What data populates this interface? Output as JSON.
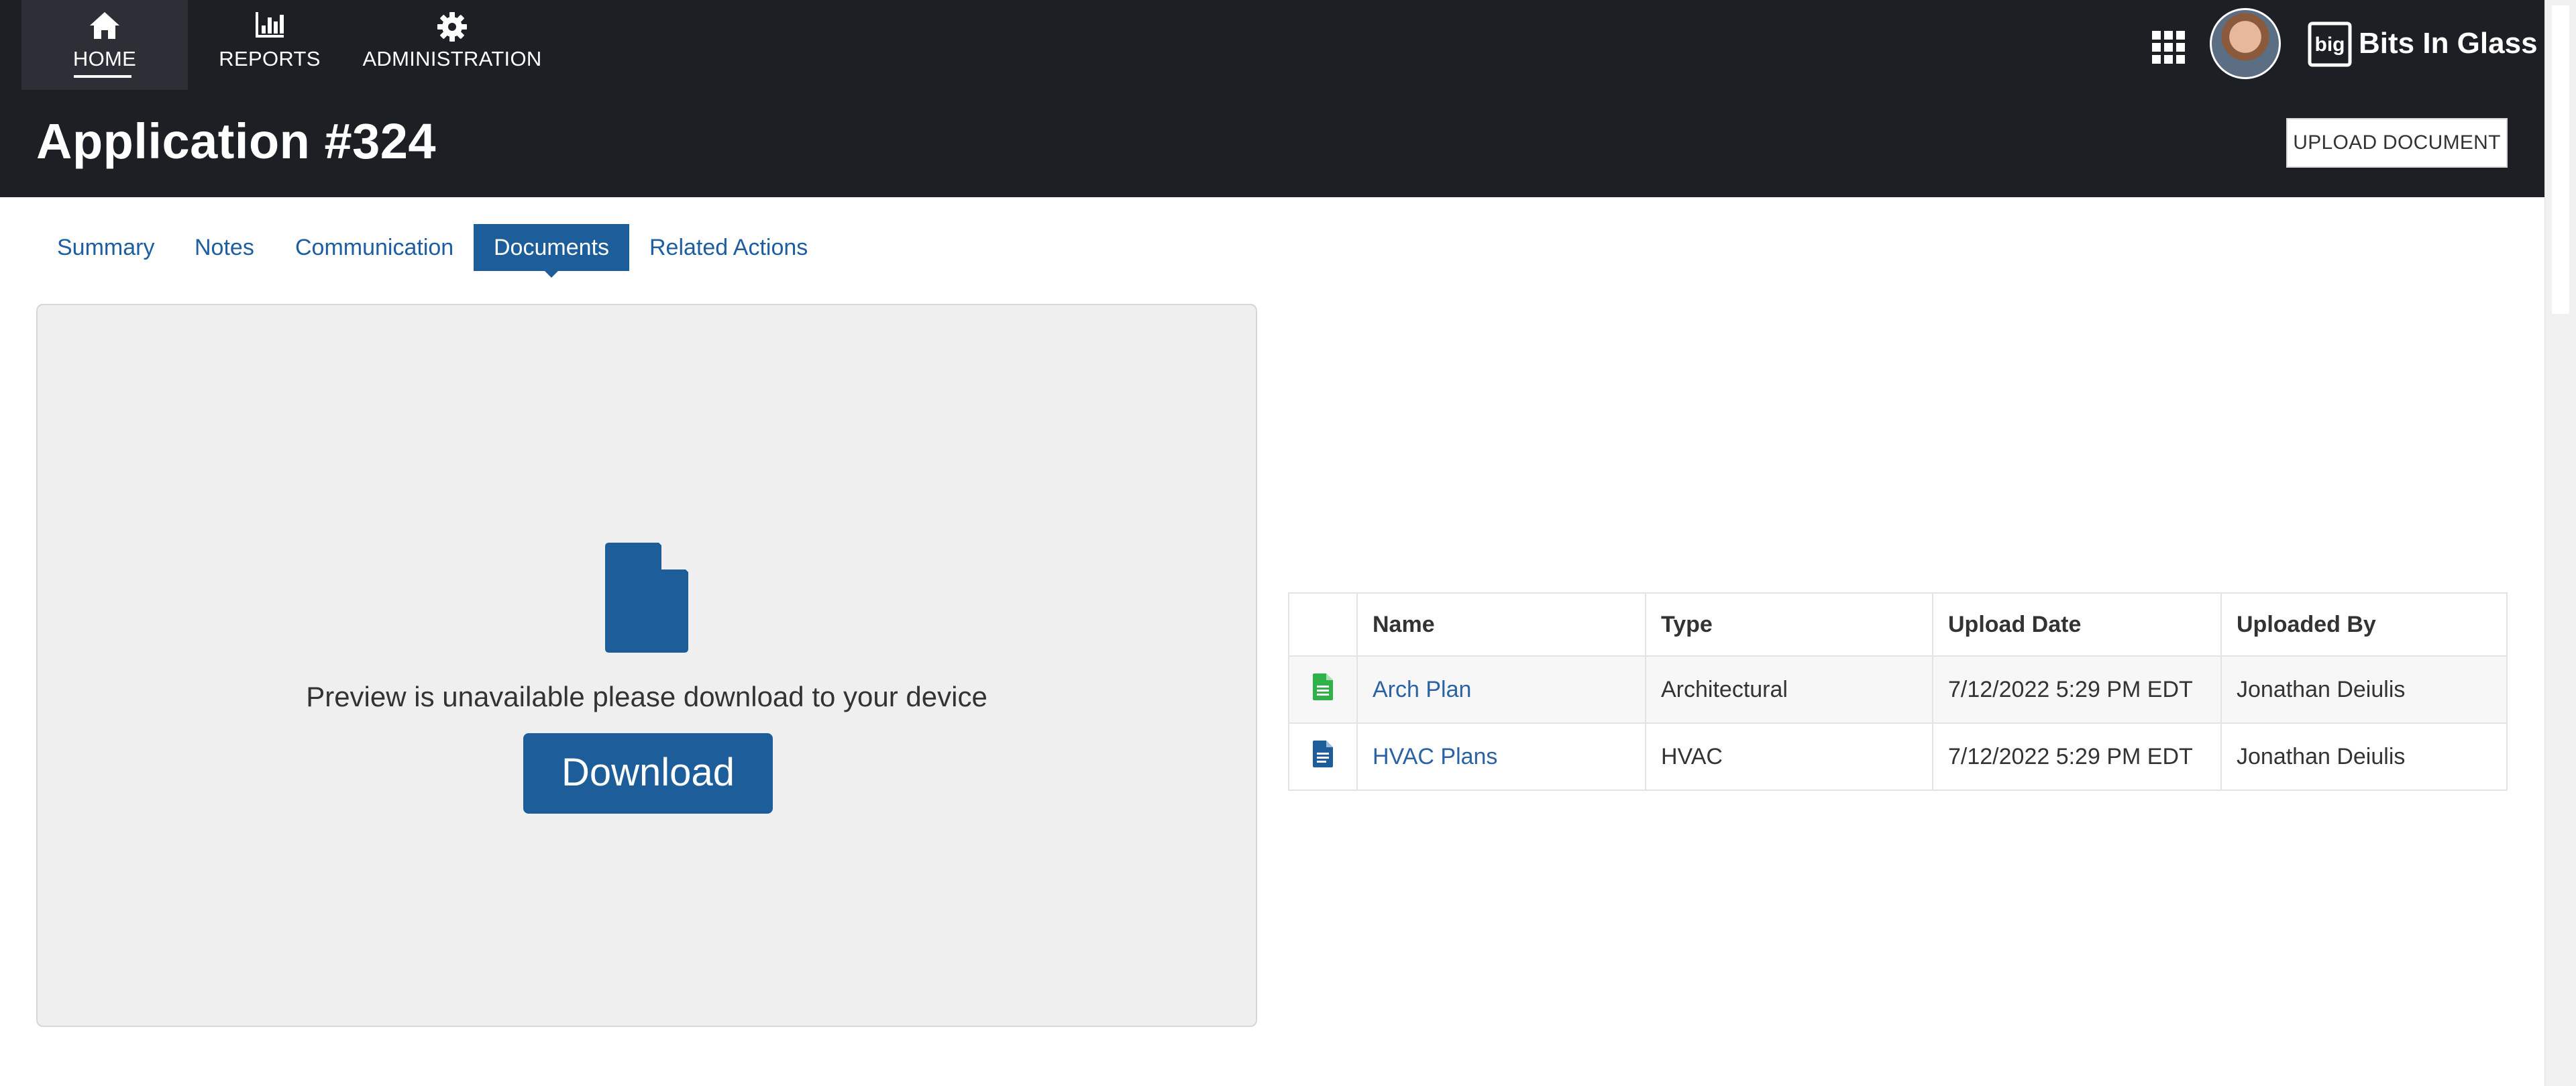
{
  "nav": {
    "items": [
      {
        "label": "HOME",
        "icon": "home-icon",
        "active": true
      },
      {
        "label": "REPORTS",
        "icon": "bar-chart-icon",
        "active": false
      },
      {
        "label": "ADMINISTRATION",
        "icon": "gear-icon",
        "active": false
      }
    ]
  },
  "header": {
    "title": "Application #324",
    "upload_button": "UPLOAD DOCUMENT",
    "brand_logo_text": "big",
    "brand_name": "Bits In Glass"
  },
  "tabs": [
    {
      "label": "Summary",
      "active": false
    },
    {
      "label": "Notes",
      "active": false
    },
    {
      "label": "Communication",
      "active": false
    },
    {
      "label": "Documents",
      "active": true
    },
    {
      "label": "Related Actions",
      "active": false
    }
  ],
  "preview": {
    "message": "Preview is unavailable please download to your device",
    "download_button": "Download"
  },
  "documents": {
    "columns": [
      "Name",
      "Type",
      "Upload Date",
      "Uploaded By"
    ],
    "rows": [
      {
        "icon": "green-document-icon",
        "name": "Arch Plan",
        "type": "Architectural",
        "upload_date": "7/12/2022 5:29 PM EDT",
        "uploaded_by": "Jonathan Deiulis"
      },
      {
        "icon": "blue-document-icon",
        "name": "HVAC Plans",
        "type": "HVAC",
        "upload_date": "7/12/2022 5:29 PM EDT",
        "uploaded_by": "Jonathan Deiulis"
      }
    ]
  },
  "colors": {
    "header_bg": "#1c1f23",
    "accent": "#1d5e9a",
    "link": "#2a62a3",
    "doc_green": "#2fb24a"
  }
}
